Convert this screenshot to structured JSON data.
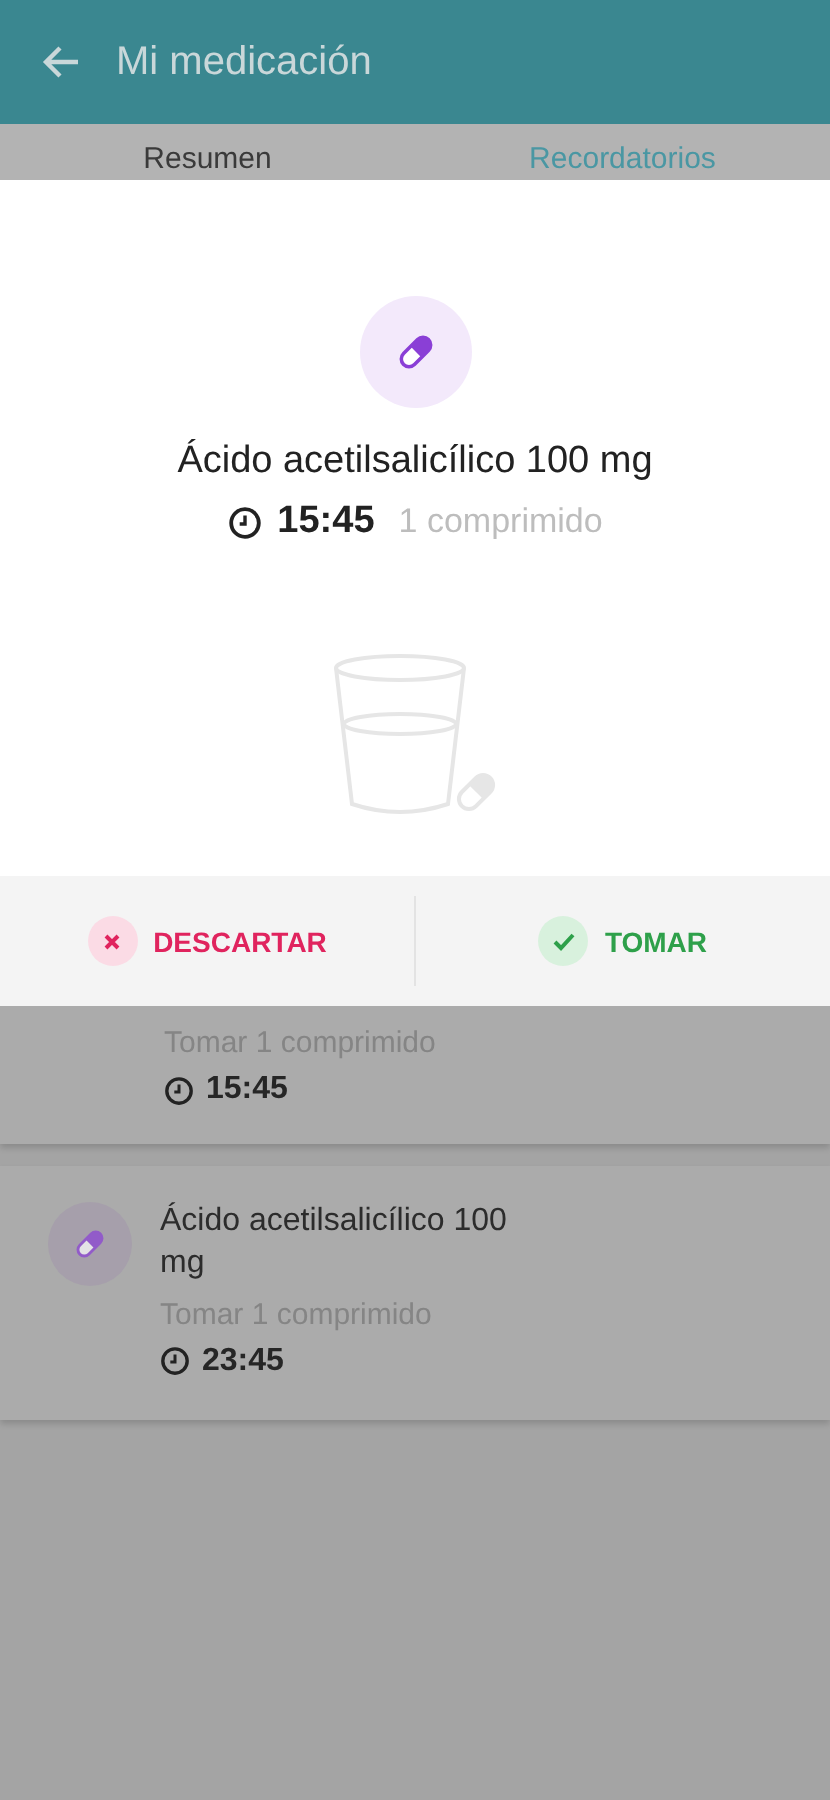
{
  "header": {
    "title": "Mi medicación"
  },
  "tabs": [
    {
      "label": "Resumen",
      "selected": false
    },
    {
      "label": "Recordatorios",
      "selected": true
    }
  ],
  "reminders": [
    {
      "dose": "Tomar 1 comprimido",
      "time": "15:45"
    },
    {
      "name": "Ácido acetilsalicílico 100 mg",
      "dose": "Tomar 1 comprimido",
      "time": "23:45"
    }
  ],
  "dialog": {
    "name": "Ácido acetilsalicílico 100 mg",
    "time": "15:45",
    "amount": "1 comprimido",
    "actions": [
      {
        "label": "DESCARTAR",
        "kind": "discard"
      },
      {
        "label": "TOMAR",
        "kind": "take"
      }
    ]
  }
}
